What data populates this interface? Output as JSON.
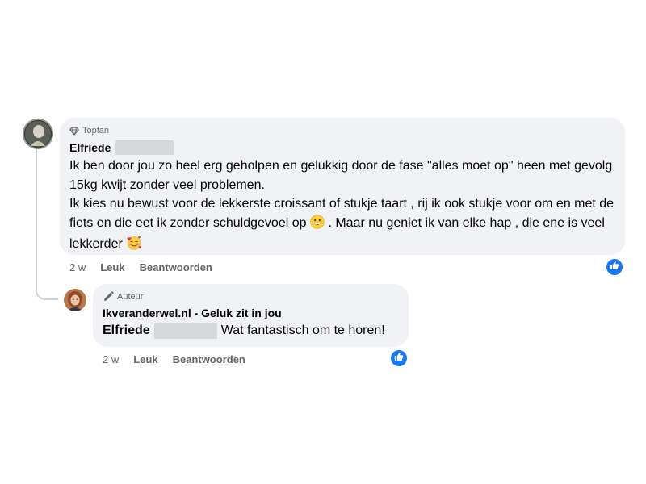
{
  "comment": {
    "badge": "Topfan",
    "author": "Elfriede",
    "paragraph1": "Ik ben door jou zo heel erg geholpen en gelukkig door de fase \"alles moet op\" heen met gevolg 15kg kwijt zonder veel problemen.",
    "paragraph2_part1": "Ik kies nu bewust voor de lekkerste croissant of stukje taart , rij ik ook stukje voor om en met de fiets en die eet ik zonder schuldgevoel op",
    "paragraph2_part2": ". Maar nu geniet ik van elke hap , die ene is veel lekkerder",
    "emoji1": "grinning-face-icon",
    "emoji2": "smiling-face-with-hearts-icon",
    "time": "2 w",
    "like_label": "Leuk",
    "reply_label": "Beantwoorden"
  },
  "reply": {
    "badge": "Auteur",
    "author": "Ikveranderwel.nl - Geluk zit in jou",
    "mention": "Elfriede",
    "text": "Wat fantastisch om te horen!",
    "time": "2 w",
    "like_label": "Leuk",
    "reply_label": "Beantwoorden"
  },
  "colors": {
    "bubble": "#f0f2f5",
    "secondary_text": "#65676b",
    "like_blue": "#1877f2",
    "redaction": "#d6d7da"
  }
}
